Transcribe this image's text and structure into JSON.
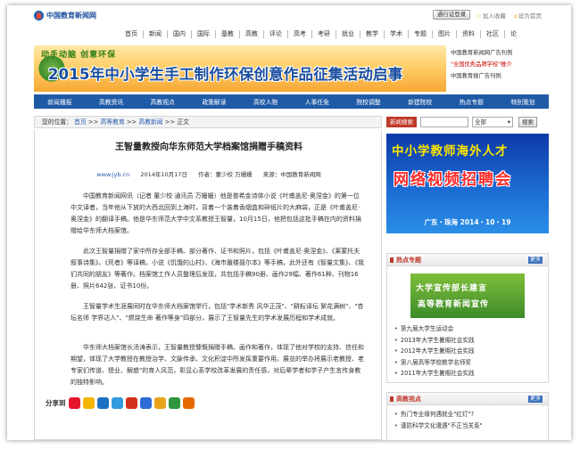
{
  "site": {
    "logo_text": "中国教育新闻网"
  },
  "top": {
    "login_label": "通行证登录",
    "links": [
      {
        "icon": "star-icon",
        "label": "加入收藏"
      },
      {
        "icon": "home-icon",
        "label": "设为首页"
      }
    ]
  },
  "mainnav": [
    "首页",
    "新闻",
    "国内",
    "国际",
    "基教",
    "高教",
    "评论",
    "高考",
    "考研",
    "就业",
    "教学",
    "学术",
    "专题",
    "图片",
    "资料",
    "社区",
    "论"
  ],
  "banner": {
    "slogan": "动手动脑  创意环保",
    "title": "2015年中小学生手工制作环保创意作品征集活动启事"
  },
  "top_side": [
    "中国教育新闻网广告刊例",
    "\"全国优秀品牌学校\"推介",
    "中国教育报广告刊例"
  ],
  "subnav": [
    "新闻播报",
    "高教资讯",
    "高教视点",
    "政策解读",
    "高校人物",
    "人事任免",
    "院校调整",
    "新建院校",
    "热点专题",
    "特别策划"
  ],
  "breadcrumb": {
    "prefix": "您的位置：",
    "items": [
      "首页",
      "高等教育",
      "高教新闻",
      "正文"
    ],
    "sep": " >> "
  },
  "article": {
    "title": "王智量教授向华东师范大学档案馆捐赠手稿资料",
    "source_site": "www.jyb.cn",
    "date": "2014年10月17日",
    "author": "作者：董少校 万姗姗",
    "origin": "来源：中国教育新闻网",
    "paragraphs": [
      "中国教育新闻网讯（记者 董少校 通讯员 万姗姗）他是普希金诗体小说《叶甫盖尼·奥涅金》的第一位中文译者，当年他从下放的大西北回到上海时，背着一个装着香烟盒和碎纸片的大麻袋，正是《叶甫盖尼·奥涅金》的翻译手稿。他是华东师范大学中文系教授王智量，10月15日，他把包括这批手稿在内的资料捐赠给华东师大档案馆。",
      "此次王智量捐赠了家中所存全部手稿、部分著作、证书和照片，包括《叶甫盖尼·奥涅金》、《莱蒙托夫叙事诗集》、《死者》等译稿，小说《饥饿的山村》、《海市蜃楼聂尔本》等手稿，此外还有《智量文集》、《我们共同的朋友》等著作。档案馆工作人员整理后发现，共包括手稿90册、画作29幅、著作61种、刊物16册、照片642张、证书10份。",
      "王智量学术生涯展同时在华东师大档案馆举行，包括\"学术新秀 风华正茂\"、\"耕耘译坛 絮花满树\"、\"杏坛名师 学界达人\"、\"燃烧生命 著作等身\"四部分，展示了王智量先生的学术发展历程和学术成就。",
      "华东师大档案馆长汤涛表示，王智量教授慷慨捐赠手稿、画作和著作，体现了他对学校的支持、信任和期望，体现了大学教授在教授治学、文脉传承、文化积淀中所发挥重要作用。展览的举办将展示老教授、老专家们传道、授业、解惑\"的育人风范，彰显心系学校改革发展的责任感，对后辈学者和学子产生言传身教的独特影响。"
    ],
    "share_label": "分享到"
  },
  "share_icons": [
    {
      "name": "weibo-share-icon",
      "color": "#e6162d"
    },
    {
      "name": "qzone-share-icon",
      "color": "#f5b400"
    },
    {
      "name": "renren-share-icon",
      "color": "#1c70c4"
    },
    {
      "name": "tencent-weibo-share-icon",
      "color": "#2f9de0"
    },
    {
      "name": "kaixin-share-icon",
      "color": "#d3301a"
    },
    {
      "name": "baidu-share-icon",
      "color": "#2e6bd6"
    },
    {
      "name": "sohu-share-icon",
      "color": "#e8a319"
    },
    {
      "name": "douban-share-icon",
      "color": "#2e963d"
    },
    {
      "name": "more-share-icon",
      "color": "#e66a00"
    }
  ],
  "right": {
    "search_label": "新闻搜索",
    "select_value": "全部",
    "search_button": "搜索",
    "recruit": {
      "line1": "中小学教师海外人才",
      "line2": "网络视频招聘会",
      "line3": "广东・珠海  2014・10・19"
    },
    "hot": {
      "title": "热点专题",
      "more": "更多",
      "image_line1": "大学宣传部长建言",
      "image_line2": "高等教育新闻宣传",
      "items": [
        "第九届大学生运动会",
        "2013年大学生暑期社会实践",
        "2012年大学生暑期社会实践",
        "第八届高等学校教学名师奖",
        "2011年大学生暑期社会实践"
      ]
    },
    "view": {
      "title": "高教视点",
      "more": "更多",
      "items": [
        "热门专业缘何遇就业\"红灯\"?",
        "谨防科学文化遭遇\"不正当关系\""
      ]
    }
  }
}
